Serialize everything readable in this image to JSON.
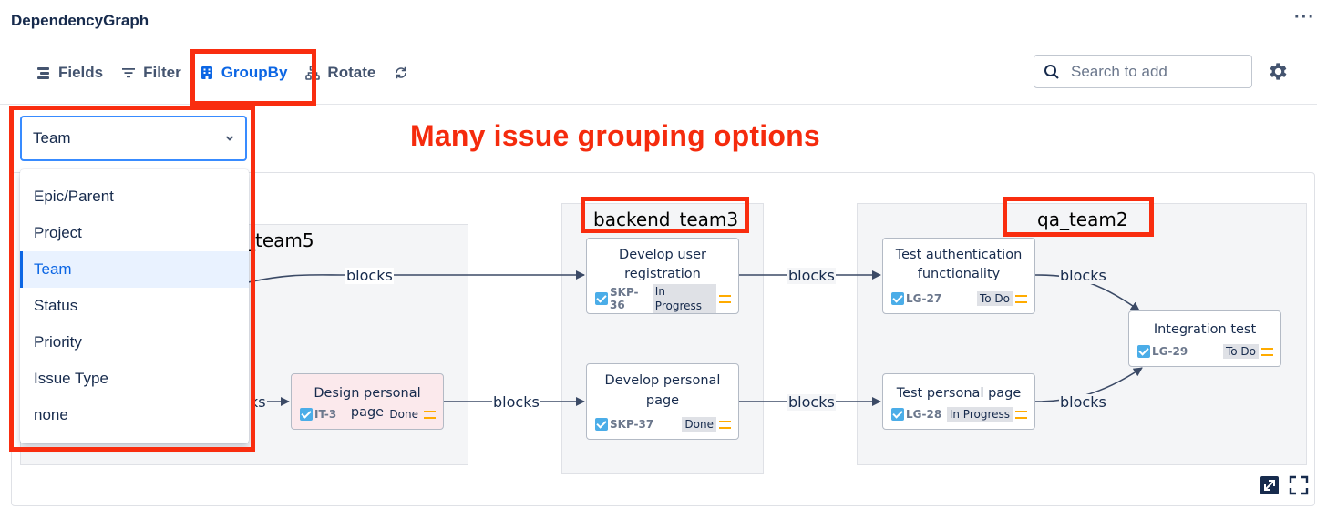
{
  "app": {
    "title": "DependencyGraph",
    "more": "···"
  },
  "toolbar": {
    "fields": "Fields",
    "filter": "Filter",
    "groupby": "GroupBy",
    "rotate": "Rotate"
  },
  "search": {
    "placeholder": "Search to add"
  },
  "groupby_select": {
    "value": "Team",
    "options": [
      "Epic/Parent",
      "Project",
      "Team",
      "Status",
      "Priority",
      "Issue Type",
      "none"
    ],
    "selected": "Team"
  },
  "callout": "Many issue grouping options",
  "groups": [
    {
      "label": "_team5"
    },
    {
      "label": "backend_team3"
    },
    {
      "label": "qa_team2"
    }
  ],
  "nodes": {
    "it3": {
      "title": "Design personal page",
      "key": "IT-3",
      "status": "Done"
    },
    "skp36": {
      "title_1": "Develop user",
      "title_2": "registration",
      "key": "SKP-36",
      "status": "In Progress"
    },
    "skp37": {
      "title_1": "Develop personal",
      "title_2": "page",
      "key": "SKP-37",
      "status": "Done"
    },
    "lg27": {
      "title_1": "Test authentication",
      "title_2": "functionality",
      "key": "LG-27",
      "status": "To Do"
    },
    "lg28": {
      "title": "Test personal page",
      "key": "LG-28",
      "status": "In Progress"
    },
    "lg29": {
      "title": "Integration test",
      "key": "LG-29",
      "status": "To Do"
    }
  },
  "edges": {
    "label": "blocks",
    "partial_label": "ks"
  },
  "colors": {
    "accent": "#0c66e4",
    "highlight": "#f92d0f",
    "issue_type": "#4bade8",
    "priority": "#ffab00"
  }
}
